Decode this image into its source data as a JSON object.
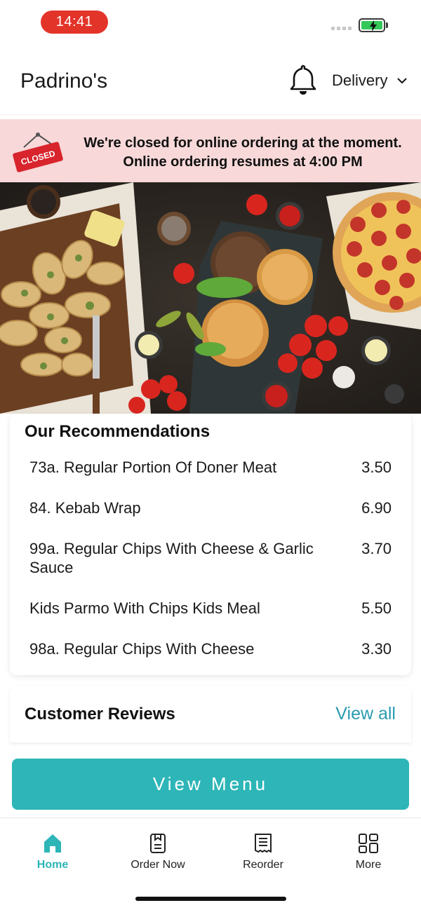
{
  "status_bar": {
    "time": "14:41"
  },
  "header": {
    "restaurant_name": "Padrino's",
    "order_mode": "Delivery",
    "bell_icon": "bell-icon"
  },
  "closed_banner": {
    "sign_text": "CLOSED",
    "line1": "We're closed for online ordering at the moment.",
    "line2": "Online ordering resumes at 4:00 PM",
    "bg_color": "#f8d8d8"
  },
  "recommendations": {
    "title": "Our Recommendations",
    "items": [
      {
        "name": "73a. Regular Portion Of Doner Meat",
        "price": "3.50"
      },
      {
        "name": "84. Kebab Wrap",
        "price": "6.90"
      },
      {
        "name": "99a. Regular Chips With Cheese & Garlic Sauce",
        "price": "3.70"
      },
      {
        "name": "Kids Parmo With Chips Kids Meal",
        "price": "5.50"
      },
      {
        "name": "98a. Regular Chips With Cheese",
        "price": "3.30"
      }
    ]
  },
  "reviews": {
    "title": "Customer Reviews",
    "view_all": "View all"
  },
  "view_menu_button": "View Menu",
  "bottom_nav": {
    "items": [
      {
        "label": "Home",
        "icon": "home-icon",
        "active": true
      },
      {
        "label": "Order Now",
        "icon": "order-icon",
        "active": false
      },
      {
        "label": "Reorder",
        "icon": "receipt-icon",
        "active": false
      },
      {
        "label": "More",
        "icon": "grid-icon",
        "active": false
      }
    ]
  },
  "colors": {
    "accent": "#2db5b7",
    "link": "#2a9bb0",
    "time_pill": "#e3342a",
    "battery": "#34c759"
  }
}
